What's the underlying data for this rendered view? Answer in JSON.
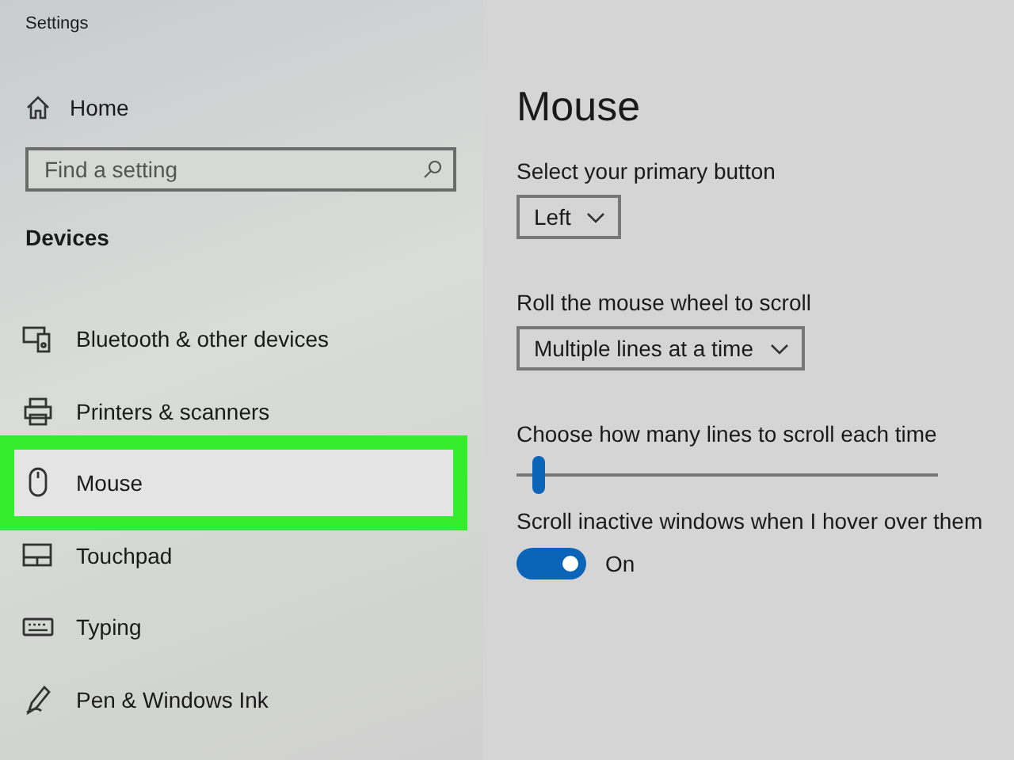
{
  "window": {
    "title": "Settings"
  },
  "sidebar": {
    "home": "Home",
    "search": {
      "placeholder": "Find a setting"
    },
    "section": "Devices",
    "items": [
      {
        "label": "Bluetooth & other devices",
        "selected": false
      },
      {
        "label": "Printers & scanners",
        "selected": false
      },
      {
        "label": "Mouse",
        "selected": true
      },
      {
        "label": "Touchpad",
        "selected": false
      },
      {
        "label": "Typing",
        "selected": false
      },
      {
        "label": "Pen & Windows Ink",
        "selected": false
      }
    ]
  },
  "content": {
    "title": "Mouse",
    "settings": [
      {
        "kind": "dropdown",
        "label": "Select your primary button",
        "value": "Left"
      },
      {
        "kind": "dropdown",
        "label": "Roll the mouse wheel to scroll",
        "value": "Multiple lines at a time"
      },
      {
        "kind": "slider",
        "label": "Choose how many lines to scroll each time",
        "level": 0.04
      },
      {
        "kind": "toggle",
        "label": "Scroll inactive windows when I hover over them",
        "on": true,
        "state": "On"
      }
    ]
  }
}
